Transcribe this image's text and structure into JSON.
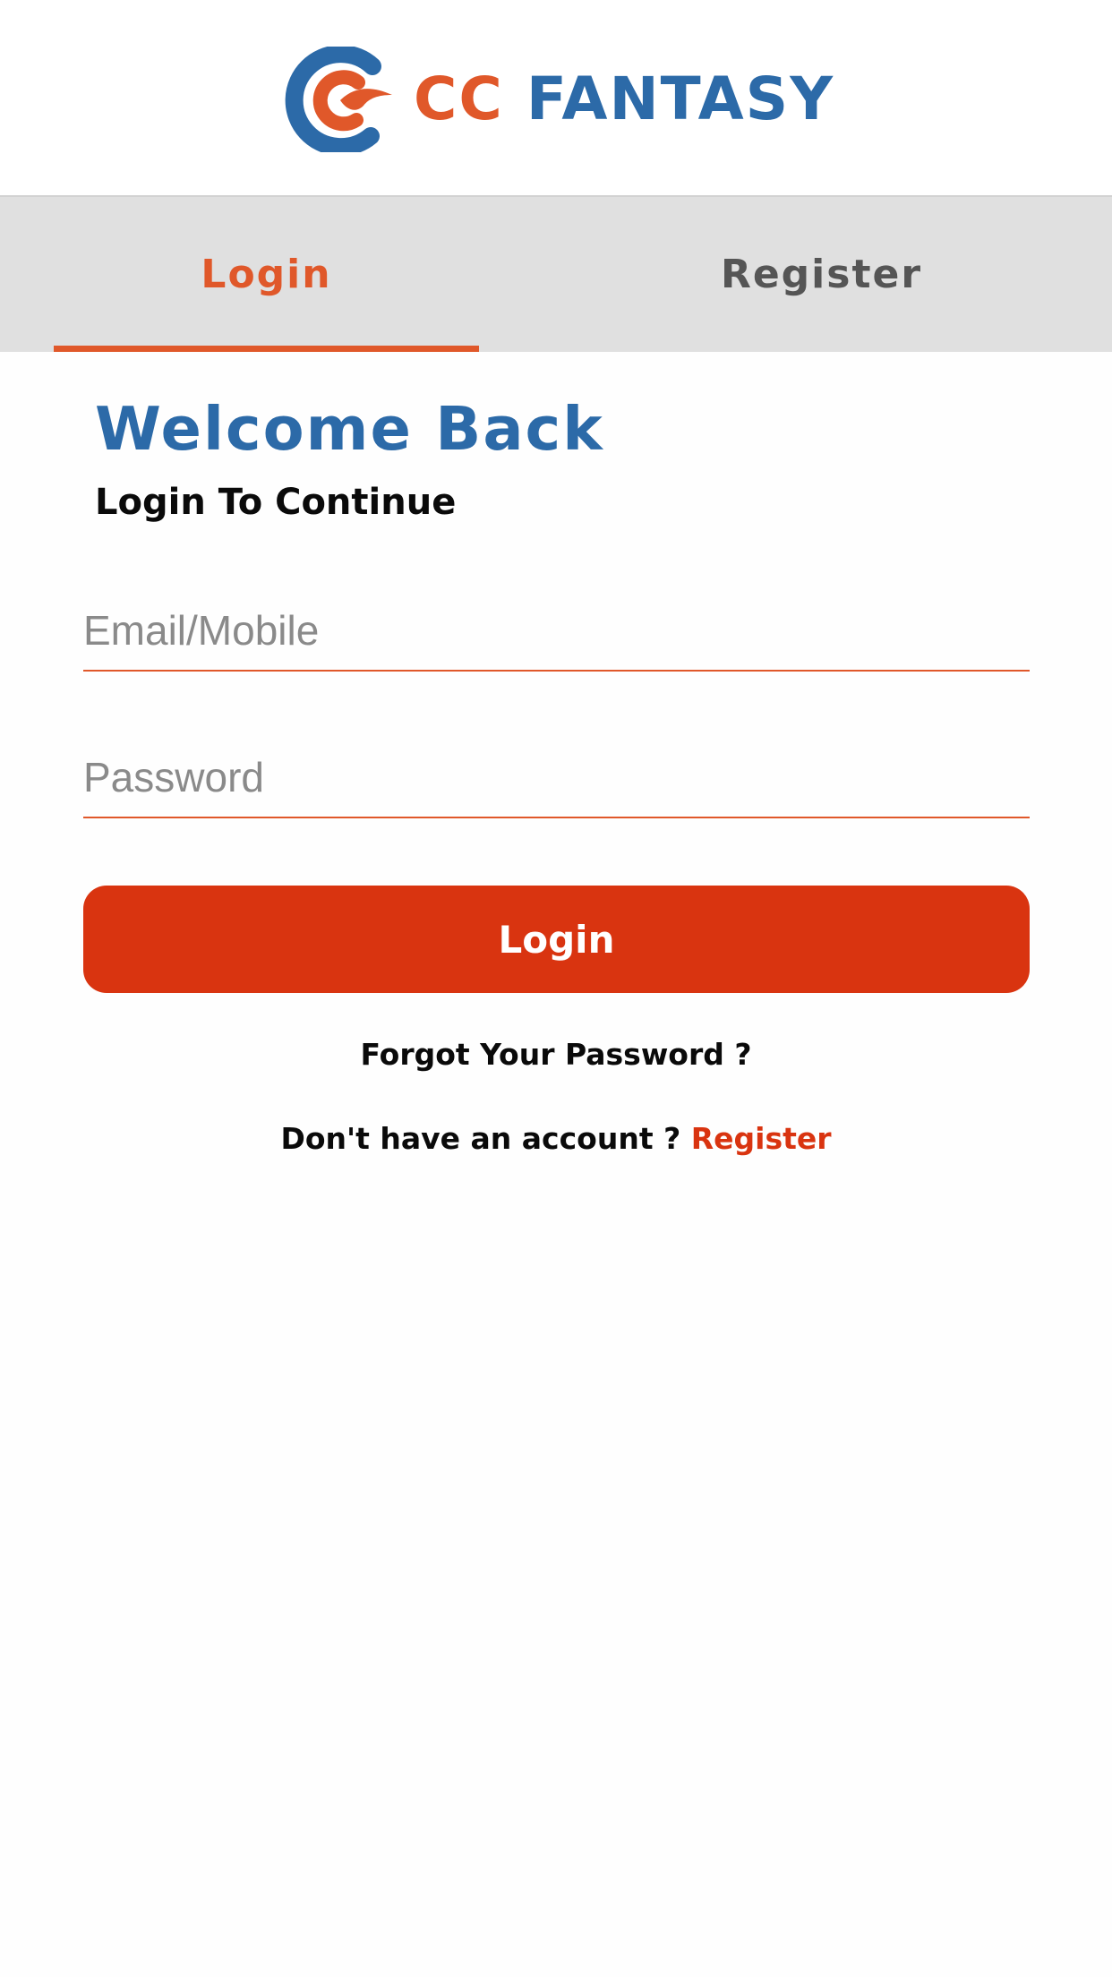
{
  "colors": {
    "brand": "#2c6aa8",
    "accent": "#e0582a",
    "button": "#d93410"
  },
  "logo": {
    "icon": "cc-fantasy-logo-icon",
    "text_cc": "CC",
    "text_fantasy": "FANTASY"
  },
  "tabs": [
    {
      "label": "Login",
      "active": true
    },
    {
      "label": "Register",
      "active": false
    }
  ],
  "form": {
    "title": "Welcome Back",
    "subtitle": "Login To Continue",
    "email_placeholder": "Email/Mobile",
    "email_value": "",
    "password_placeholder": "Password",
    "password_value": "",
    "submit_label": "Login",
    "forgot_label": "Forgot Your Password ?",
    "no_account_text": "Don't have an account ?",
    "register_link": "Register"
  }
}
